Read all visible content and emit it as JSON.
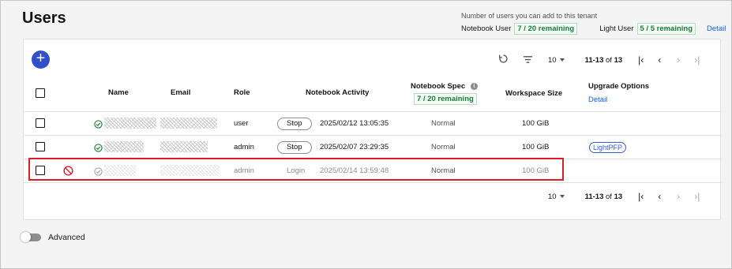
{
  "page": {
    "title": "Users"
  },
  "quota": {
    "caption": "Number of users you can add to this tenant",
    "notebook_label": "Notebook User",
    "notebook_remaining": "7 / 20 remaining",
    "light_label": "Light User",
    "light_remaining": "5 / 5 remaining",
    "detail_link": "Detail"
  },
  "toolbar": {
    "add_icon": "plus-icon",
    "refresh_icon": "refresh-icon",
    "filter_icon": "filter-icon"
  },
  "pagination_top": {
    "page_size": "10",
    "range": "11-13",
    "of_label": "of",
    "total": "13"
  },
  "pagination_bottom": {
    "page_size": "10",
    "range": "11-13",
    "of_label": "of",
    "total": "13"
  },
  "table": {
    "headers": {
      "name": "Name",
      "email": "Email",
      "role": "Role",
      "notebook_activity": "Notebook Activity",
      "notebook_spec": "Notebook Spec",
      "notebook_spec_badge": "7 / 20 remaining",
      "workspace_size": "Workspace Size",
      "upgrade_options": "Upgrade Options",
      "upgrade_detail": "Detail"
    },
    "rows": [
      {
        "status": "active",
        "role": "user",
        "action": "Stop",
        "activity": "2025/02/12 13:05:35",
        "spec": "Normal",
        "workspace": "100 GiB",
        "upgrade": ""
      },
      {
        "status": "active",
        "role": "admin",
        "action": "Stop",
        "activity": "2025/02/07 23:29:35",
        "spec": "Normal",
        "workspace": "100 GiB",
        "upgrade": "LightPFP"
      },
      {
        "status": "inactive",
        "role": "admin",
        "action": "Login",
        "activity": "2025/02/14 13:59:48",
        "spec": "Normal",
        "workspace": "100 GiB",
        "upgrade": ""
      }
    ]
  },
  "footer": {
    "advanced_label": "Advanced"
  }
}
